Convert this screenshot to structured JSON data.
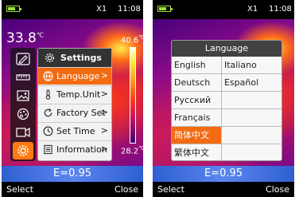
{
  "status": {
    "zoom": "X1",
    "time": "11:08"
  },
  "left_screen": {
    "center_temperature": "33.8",
    "temp_unit_symbol": "℃",
    "scale_max": "40.6",
    "scale_min": "28.2",
    "emissivity": "E=0.95",
    "softkeys": {
      "left": "Select",
      "right": "Close"
    },
    "settings_menu": {
      "title": "Settings",
      "items": [
        {
          "label": "Language",
          "arrow": ">",
          "icon": "globe-icon"
        },
        {
          "label": "Temp.Unit",
          "arrow": ">",
          "icon": "thermometer-icon"
        },
        {
          "label": "Factory Set",
          "arrow": ">",
          "icon": "reset-icon"
        },
        {
          "label": "Set Time",
          "arrow": ">",
          "icon": "clock-icon"
        },
        {
          "label": "Information",
          "arrow": ">",
          "icon": "info-list-icon"
        }
      ]
    },
    "side_icons": [
      "pen-icon",
      "ruler-icon",
      "image-icon",
      "palette-icon",
      "video-icon",
      "gear-icon"
    ]
  },
  "right_screen": {
    "emissivity": "E=0.95",
    "softkeys": {
      "left": "Select",
      "right": "Close"
    },
    "language_menu": {
      "title": "Language",
      "rows": [
        [
          "English",
          "Italiano"
        ],
        [
          "Deutsch",
          "Español"
        ],
        [
          "Pусский",
          ""
        ],
        [
          "Français",
          ""
        ],
        [
          "简体中文",
          ""
        ],
        [
          "繁体中文",
          ""
        ]
      ]
    }
  },
  "colors": {
    "accent": "#f26b12",
    "battery": "#9be03c",
    "emissivity_bar": "#4a76e6"
  }
}
